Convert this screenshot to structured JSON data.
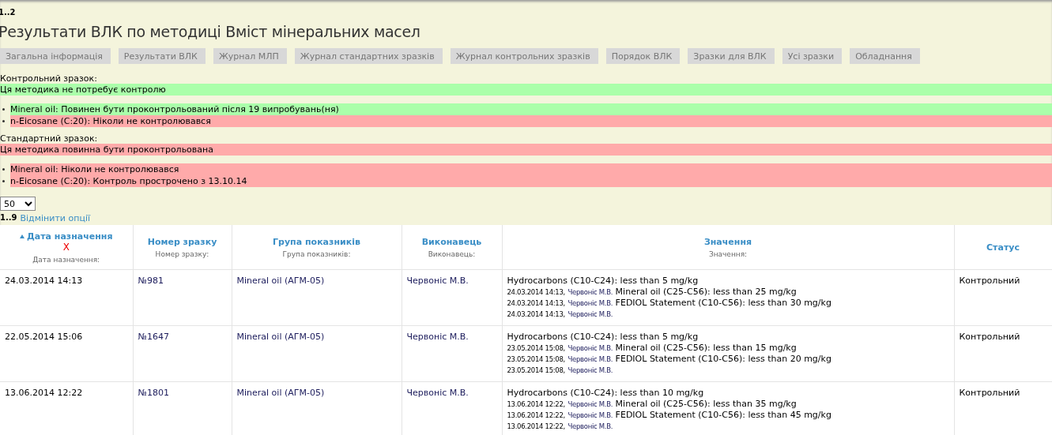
{
  "counter": "1..2",
  "title": "Результати ВЛК по методиці Вміст мінеральних масел",
  "tabs": [
    {
      "label": "Загальна інформація",
      "selected": false
    },
    {
      "label": "Результати ВЛК",
      "selected": false
    },
    {
      "label": "Журнал МЛП",
      "selected": false
    },
    {
      "label": "Журнал стандартних зразків",
      "selected": false
    },
    {
      "label": "Журнал контрольних зразків",
      "selected": false
    },
    {
      "label": "Порядок ВЛК",
      "selected": false
    },
    {
      "label": "Зразки для ВЛК",
      "selected": false
    },
    {
      "label": "Усі зразки",
      "selected": false
    },
    {
      "label": "Обладнання",
      "selected": false
    }
  ],
  "sections": [
    {
      "heading": "Контрольний зразок:",
      "summary": {
        "text": "Ця методика не потребує контролю",
        "ok": true
      },
      "items": [
        {
          "text": "Mineral oil: Повинен бути проконтрольований після 19 випробувань(ня)",
          "ok": true
        },
        {
          "text": "n-Eicosane (C:20): Ніколи не контролювався",
          "ok": false
        }
      ]
    },
    {
      "heading": "Стандартний зразок:",
      "summary": {
        "text": "Ця методика повинна бути проконтрольована",
        "ok": false
      },
      "items": [
        {
          "text": "Mineral oil: Ніколи не контролювався",
          "ok": false
        },
        {
          "text": "n-Eicosane (C:20): Контроль прострочено з 13.10.14",
          "ok": false
        }
      ]
    }
  ],
  "page_size": {
    "value": "50"
  },
  "filter": {
    "counter": "1..9",
    "link": "Відмінити опції"
  },
  "table": {
    "columns": [
      {
        "title": "Дата назначення",
        "sorted": true,
        "clear": "X",
        "filter_label": "Дата назначення:"
      },
      {
        "title": "Номер зразку",
        "sorted": false,
        "filter_label": "Номер зразку:"
      },
      {
        "title": "Група показників",
        "sorted": false,
        "filter_label": "Група показників:"
      },
      {
        "title": "Виконавець",
        "sorted": false,
        "filter_label": "Виконавець:"
      },
      {
        "title": "Значення",
        "sorted": false,
        "filter_label": "Значення:"
      },
      {
        "title": "Статус",
        "sorted": false
      }
    ],
    "rows": [
      {
        "date": "24.03.2014 14:13",
        "number": "№981",
        "group": "Mineral oil (АГМ-05)",
        "performer": "Червоніс М.В.",
        "values": [
          {
            "result": "Hydrocarbons (C10-C24): less than 5 mg/kg",
            "date": "24.03.2014 14:13,",
            "author": "Червоніс М.В."
          },
          {
            "result": "Mineral oil (C25-C56): less than 25 mg/kg",
            "date": "24.03.2014 14:13,",
            "author": "Червоніс М.В."
          },
          {
            "result": "FEDIOL Statement (C10-C56): less than 30 mg/kg",
            "date": "24.03.2014 14:13,",
            "author": "Червоніс М.В."
          }
        ],
        "status": "Контрольний"
      },
      {
        "date": "22.05.2014 15:06",
        "number": "№1647",
        "group": "Mineral oil (АГМ-05)",
        "performer": "Червоніс М.В.",
        "values": [
          {
            "result": "Hydrocarbons (C10-C24): less than 5 mg/kg",
            "date": "23.05.2014 15:08,",
            "author": "Червоніс М.В."
          },
          {
            "result": "Mineral oil (C25-C56): less than 15 mg/kg",
            "date": "23.05.2014 15:08,",
            "author": "Червоніс М.В."
          },
          {
            "result": "FEDIOL Statement (C10-C56): less than 20 mg/kg",
            "date": "23.05.2014 15:08,",
            "author": "Червоніс М.В."
          }
        ],
        "status": "Контрольний"
      },
      {
        "date": "13.06.2014 12:22",
        "number": "№1801",
        "group": "Mineral oil (АГМ-05)",
        "performer": "Червоніс М.В.",
        "values": [
          {
            "result": "Hydrocarbons (C10-C24): less than 10 mg/kg",
            "date": "13.06.2014 12:22,",
            "author": "Червоніс М.В."
          },
          {
            "result": "Mineral oil (C25-C56): less than 35 mg/kg",
            "date": "13.06.2014 12:22,",
            "author": "Червоніс М.В."
          },
          {
            "result": "FEDIOL Statement (C10-C56): less than 45 mg/kg",
            "date": "13.06.2014 12:22,",
            "author": "Червоніс М.В."
          }
        ],
        "status": "Контрольний"
      }
    ]
  }
}
